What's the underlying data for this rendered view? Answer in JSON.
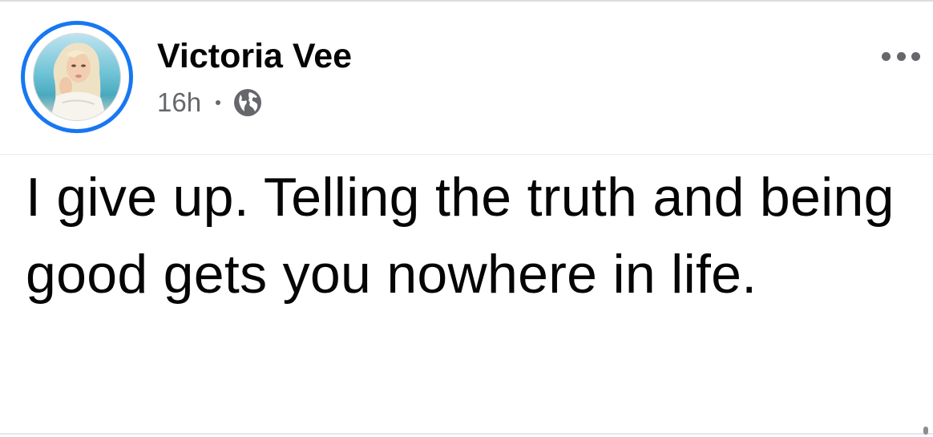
{
  "post": {
    "author": "Victoria Vee",
    "timestamp": "16h",
    "privacy_icon": "globe-icon",
    "more_icon": "more-options-icon",
    "text": "I give up. Telling the truth and being good gets you nowhere in life."
  },
  "colors": {
    "avatar_ring": "#1877f2",
    "author_text": "#050505",
    "meta_text": "#65676b",
    "background": "#ffffff"
  }
}
